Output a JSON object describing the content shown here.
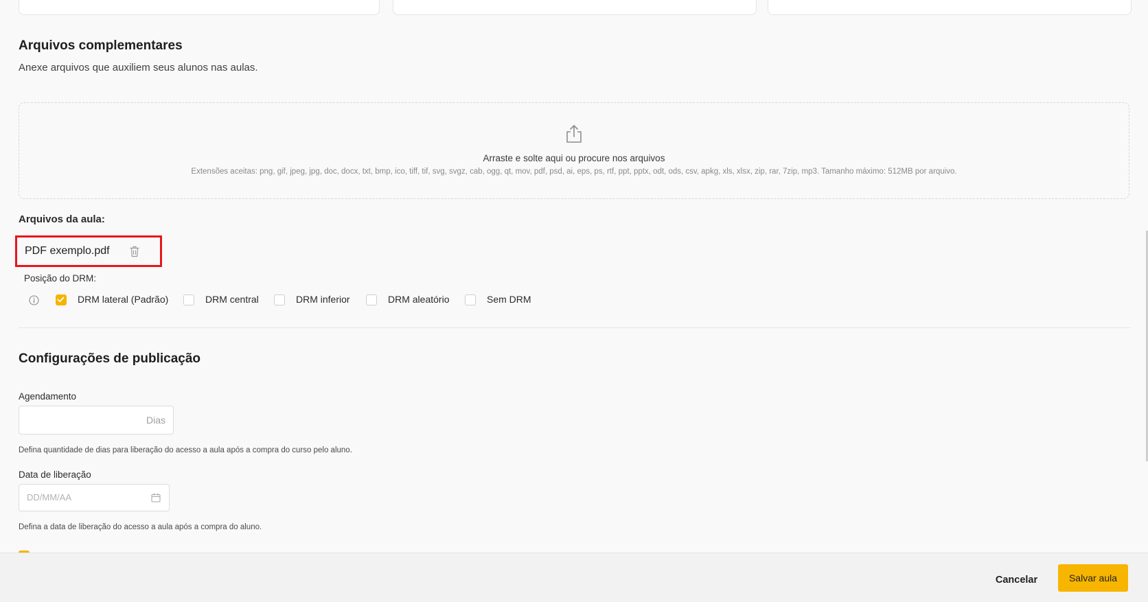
{
  "complementary": {
    "title": "Arquivos complementares",
    "subtitle": "Anexe arquivos que auxiliem seus alunos nas aulas."
  },
  "dropzone": {
    "icon": "upload-icon",
    "main_text": "Arraste e solte aqui ou procure nos arquivos",
    "extensions_text": "Extensões aceitas: png, gif, jpeg, jpg, doc, docx, txt, bmp, ico, tiff, tif, svg, svgz, cab, ogg, qt, mov, pdf, psd, ai, eps, ps, rtf, ppt, pptx, odt, ods, csv, apkg, xls, xlsx, zip, rar, 7zip, mp3. Tamanho máximo: 512MB por arquivo."
  },
  "lesson_files": {
    "label": "Arquivos da aula:",
    "files": [
      {
        "name": "PDF exemplo.pdf",
        "icon": "trash-icon"
      }
    ],
    "highlight_color": "#e8151b"
  },
  "drm": {
    "label": "Posição do DRM:",
    "options": [
      {
        "label": "DRM lateral (Padrão)",
        "checked": true
      },
      {
        "label": "DRM central",
        "checked": false
      },
      {
        "label": "DRM inferior",
        "checked": false
      },
      {
        "label": "DRM aleatório",
        "checked": false
      },
      {
        "label": "Sem DRM",
        "checked": false
      }
    ]
  },
  "publication": {
    "title": "Configurações de publicação",
    "schedule": {
      "label": "Agendamento",
      "value": "",
      "suffix": "Dias",
      "help": "Defina quantidade de dias para liberação do acesso a aula após a compra do curso pelo aluno."
    },
    "release_date": {
      "label": "Data de liberação",
      "placeholder": "DD/MM/AA",
      "icon": "calendar-icon",
      "help": "Defina a data de liberação do acesso a aula após a compra do aluno."
    }
  },
  "footer": {
    "cancel_label": "Cancelar",
    "save_label": "Salvar aula"
  },
  "colors": {
    "accent": "#f7b500",
    "background": "#f9f9f9"
  }
}
